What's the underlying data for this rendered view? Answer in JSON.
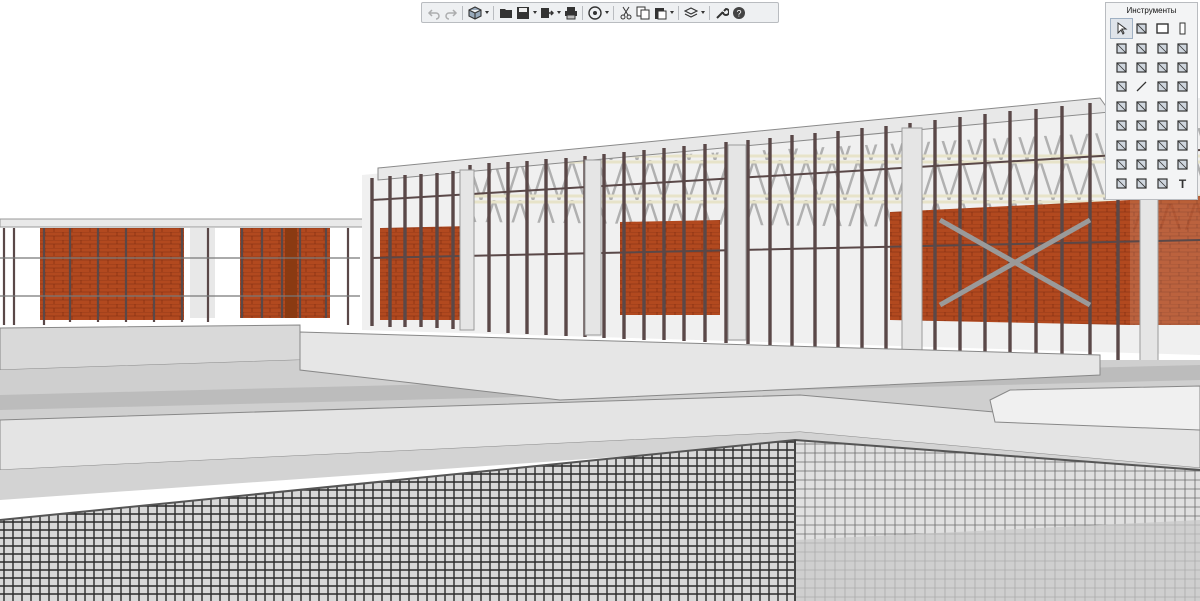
{
  "toolbar": {
    "buttons": [
      {
        "name": "undo-icon",
        "enabled": false
      },
      {
        "name": "redo-icon",
        "enabled": false
      },
      {
        "name": "view-cube-icon",
        "enabled": true,
        "dropdown": true
      },
      {
        "name": "open-folder-icon",
        "enabled": true
      },
      {
        "name": "save-icon",
        "enabled": true,
        "dropdown": true
      },
      {
        "name": "export-icon",
        "enabled": true,
        "dropdown": true
      },
      {
        "name": "print-icon",
        "enabled": true
      },
      {
        "name": "navigation-icon",
        "enabled": true,
        "dropdown": true
      },
      {
        "name": "cut-icon",
        "enabled": true
      },
      {
        "name": "copy-icon",
        "enabled": true
      },
      {
        "name": "paste-icon",
        "enabled": true,
        "dropdown": true
      },
      {
        "name": "layers-icon",
        "enabled": true,
        "dropdown": true
      },
      {
        "name": "settings-wrench-icon",
        "enabled": true
      },
      {
        "name": "help-icon",
        "enabled": true
      }
    ]
  },
  "tools_panel": {
    "title": "Инструменты",
    "tools": [
      {
        "name": "select-arrow-icon",
        "active": true
      },
      {
        "name": "slab-icon"
      },
      {
        "name": "wall-icon"
      },
      {
        "name": "column-icon"
      },
      {
        "name": "floor-icon"
      },
      {
        "name": "beam-icon"
      },
      {
        "name": "roof-icon"
      },
      {
        "name": "stair-icon"
      },
      {
        "name": "rebar-icon"
      },
      {
        "name": "mesh-icon"
      },
      {
        "name": "door-icon"
      },
      {
        "name": "window-icon"
      },
      {
        "name": "railing-icon"
      },
      {
        "name": "line-icon"
      },
      {
        "name": "fixture-icon"
      },
      {
        "name": "pipe-icon"
      },
      {
        "name": "equipment-icon"
      },
      {
        "name": "panel-icon"
      },
      {
        "name": "truss-icon"
      },
      {
        "name": "duct-icon"
      },
      {
        "name": "fitting-icon"
      },
      {
        "name": "anchor-icon"
      },
      {
        "name": "plate-icon"
      },
      {
        "name": "bolt-icon"
      },
      {
        "name": "opening-icon"
      },
      {
        "name": "profile-icon"
      },
      {
        "name": "connection-icon"
      },
      {
        "name": "weld-icon"
      },
      {
        "name": "zone-icon"
      },
      {
        "name": "space-icon"
      },
      {
        "name": "grid-icon"
      },
      {
        "name": "section-icon"
      },
      {
        "name": "dimension-icon"
      },
      {
        "name": "spline-icon"
      },
      {
        "name": "label-icon"
      },
      {
        "name": "text-icon"
      }
    ]
  },
  "colors": {
    "steel": "#5a4848",
    "brick": "#b2491f",
    "concrete": "#bfbfbf",
    "truss": "#b9b9b9"
  }
}
